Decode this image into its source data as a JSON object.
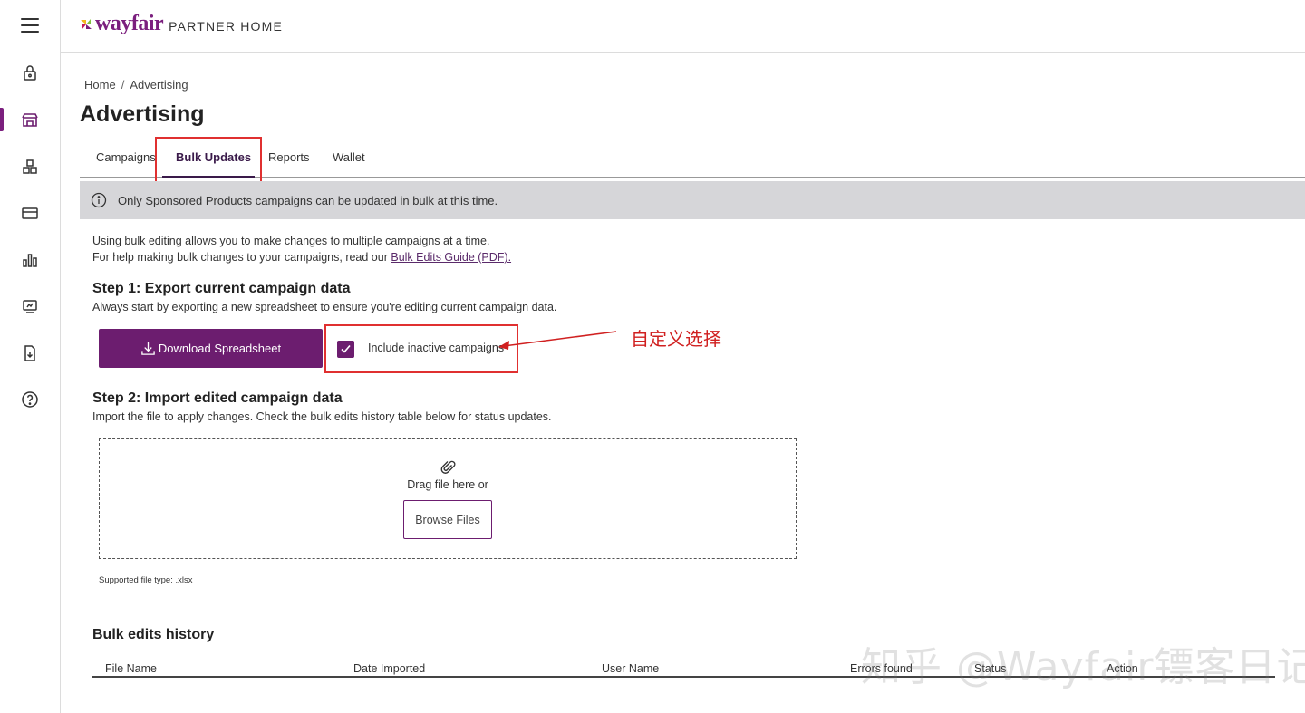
{
  "app": {
    "brand": "wayfair",
    "brand_sub": "PARTNER HOME"
  },
  "rail": {
    "items": [
      {
        "icon": "lock-bag-icon"
      },
      {
        "icon": "storefront-icon",
        "active": true
      },
      {
        "icon": "boxes-icon"
      },
      {
        "icon": "card-icon"
      },
      {
        "icon": "bar-chart-icon"
      },
      {
        "icon": "dashboard-icon"
      },
      {
        "icon": "download-doc-icon"
      },
      {
        "icon": "help-icon"
      }
    ]
  },
  "breadcrumb": {
    "home": "Home",
    "separator": "/",
    "current": "Advertising"
  },
  "page": {
    "title": "Advertising"
  },
  "tabs": [
    {
      "label": "Campaigns"
    },
    {
      "label": "Bulk Updates",
      "active": true
    },
    {
      "label": "Reports"
    },
    {
      "label": "Wallet"
    }
  ],
  "banner": {
    "text": "Only Sponsored Products campaigns can be updated in bulk at this time."
  },
  "intro": {
    "line1": "Using bulk editing allows you to make changes to multiple campaigns at a time.",
    "line2_prefix": "For help making bulk changes to your campaigns, read our ",
    "link": "Bulk Edits Guide (PDF)."
  },
  "step1": {
    "title": "Step 1: Export current campaign data",
    "desc": "Always start by exporting a new spreadsheet to ensure you're editing current campaign data.",
    "button": "Download Spreadsheet",
    "checkbox_label": "Include inactive campaigns",
    "checkbox_checked": true
  },
  "annotation": {
    "text": "自定义选择",
    "color": "#d02020"
  },
  "step2": {
    "title": "Step 2: Import edited campaign data",
    "desc": "Import the file to apply changes. Check the bulk edits history table below for status updates.",
    "drop_text": "Drag file here or",
    "browse": "Browse Files",
    "supported": "Supported file type: .xlsx"
  },
  "history": {
    "title": "Bulk edits history",
    "columns": [
      "File Name",
      "Date Imported",
      "User Name",
      "Errors found",
      "Status",
      "Action"
    ]
  },
  "watermark": "知乎 @Wayfair镖客日记",
  "colors": {
    "brand_purple": "#6c1d6f",
    "highlight_red": "#e03030",
    "banner_gray": "#d6d6d9"
  }
}
